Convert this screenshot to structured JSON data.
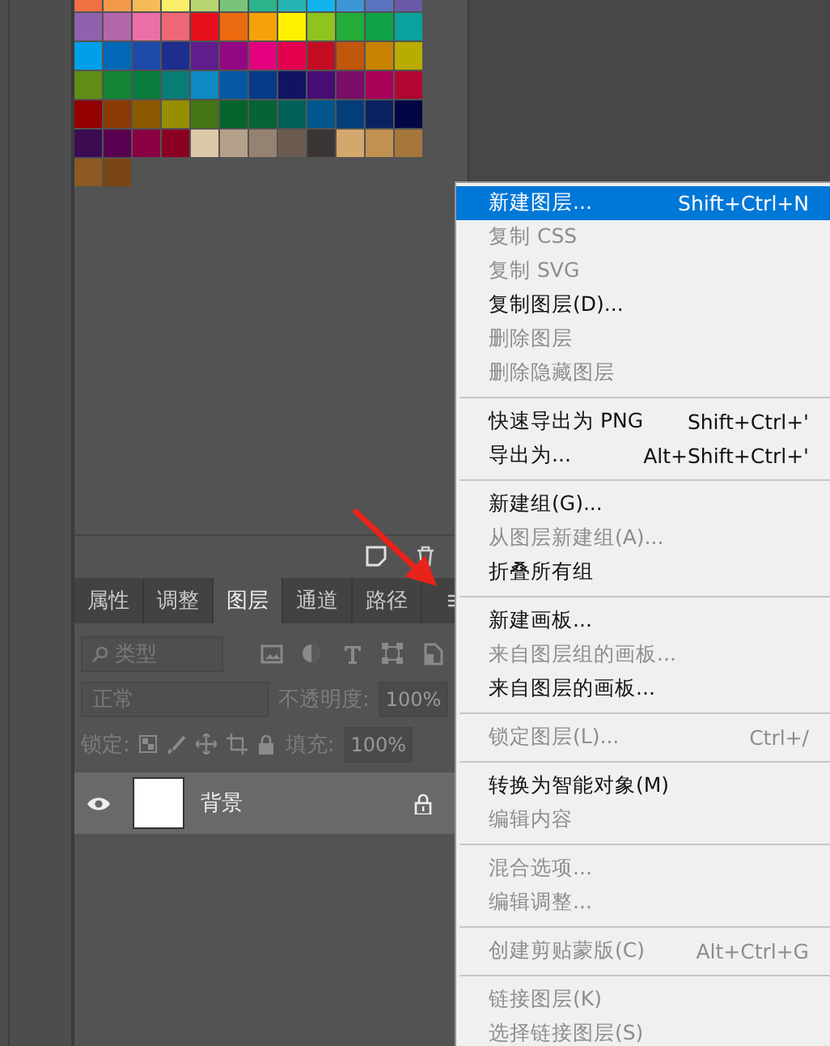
{
  "swatches": [
    {
      "color": "#ee7043"
    },
    {
      "color": "#f4994a"
    },
    {
      "color": "#f7bc57"
    },
    {
      "color": "#fbee6a"
    },
    {
      "color": "#b6d66f"
    },
    {
      "color": "#7ac37d"
    },
    {
      "color": "#2bb38a"
    },
    {
      "color": "#25b5b5"
    },
    {
      "color": "#10b4ef"
    },
    {
      "color": "#3f96d6"
    },
    {
      "color": "#5b73be"
    },
    {
      "color": "#6c5aa9"
    },
    {
      "color": "#8e62ac"
    },
    {
      "color": "#b466ab"
    },
    {
      "color": "#ea6fa6"
    },
    {
      "color": "#ee6777"
    },
    {
      "color": "#e6101d"
    },
    {
      "color": "#ec6b10"
    },
    {
      "color": "#f6a10a"
    },
    {
      "color": "#fff000"
    },
    {
      "color": "#8fc31f"
    },
    {
      "color": "#23ac38"
    },
    {
      "color": "#0ea244"
    },
    {
      "color": "#0aa29c"
    },
    {
      "color": "#00a0e9"
    },
    {
      "color": "#0068b7"
    },
    {
      "color": "#1d4aa7"
    },
    {
      "color": "#1d2e8f"
    },
    {
      "color": "#601e8d"
    },
    {
      "color": "#920783"
    },
    {
      "color": "#e4007f"
    },
    {
      "color": "#e5004f"
    },
    {
      "color": "#c30d23"
    },
    {
      "color": "#c0570c"
    },
    {
      "color": "#c68200"
    },
    {
      "color": "#b9ac00"
    },
    {
      "color": "#5f8d16"
    },
    {
      "color": "#138432"
    },
    {
      "color": "#0a7c3d"
    },
    {
      "color": "#097c74"
    },
    {
      "color": "#0d8ac2"
    },
    {
      "color": "#0559a4"
    },
    {
      "color": "#073a87"
    },
    {
      "color": "#101463"
    },
    {
      "color": "#460e74"
    },
    {
      "color": "#790d69"
    },
    {
      "color": "#a90058"
    },
    {
      "color": "#b00631"
    },
    {
      "color": "#920000"
    },
    {
      "color": "#8b3a06"
    },
    {
      "color": "#8c5a00"
    },
    {
      "color": "#978e00"
    },
    {
      "color": "#457415"
    },
    {
      "color": "#05642b"
    },
    {
      "color": "#076236"
    },
    {
      "color": "#03615c"
    },
    {
      "color": "#01568d"
    },
    {
      "color": "#043e7a"
    },
    {
      "color": "#0a2260"
    },
    {
      "color": "#000744"
    },
    {
      "color": "#3b0c52"
    },
    {
      "color": "#5a0050"
    },
    {
      "color": "#8a0042"
    },
    {
      "color": "#8a0022"
    },
    {
      "color": "#dcc9a9"
    },
    {
      "color": "#b5a18a"
    },
    {
      "color": "#958371"
    },
    {
      "color": "#6c5c50"
    },
    {
      "color": "#3b3635"
    },
    {
      "color": "#d4a76c"
    },
    {
      "color": "#c19152"
    },
    {
      "color": "#a5773d"
    },
    {
      "color": "#8c5a22"
    },
    {
      "color": "#7a4514"
    }
  ],
  "layers_panel": {
    "tabs": [
      {
        "label": "属性",
        "selected": false
      },
      {
        "label": "调整",
        "selected": false
      },
      {
        "label": "图层",
        "selected": true
      },
      {
        "label": "通道",
        "selected": false
      },
      {
        "label": "路径",
        "selected": false
      }
    ],
    "filter_kind": "类型",
    "blend_mode": "正常",
    "opacity_label": "不透明度:",
    "opacity": "100%",
    "lock_label": "锁定:",
    "fill_label": "填充:",
    "fill": "100%",
    "layers": [
      {
        "name": "背景",
        "visible": true,
        "locked": true
      }
    ]
  },
  "context_menu": {
    "items": [
      {
        "kind": "item",
        "label": "新建图层...",
        "shortcut": "Shift+Ctrl+N",
        "disabled": false,
        "selected": true
      },
      {
        "kind": "item",
        "label": "复制 CSS",
        "disabled": true,
        "selected": false
      },
      {
        "kind": "item",
        "label": "复制 SVG",
        "disabled": true,
        "selected": false
      },
      {
        "kind": "item",
        "label": "复制图层(D)...",
        "disabled": false,
        "selected": false
      },
      {
        "kind": "item",
        "label": "删除图层",
        "disabled": true,
        "selected": false
      },
      {
        "kind": "item",
        "label": "删除隐藏图层",
        "disabled": true,
        "selected": false
      },
      {
        "kind": "separator"
      },
      {
        "kind": "item",
        "label": "快速导出为 PNG",
        "shortcut": "Shift+Ctrl+'",
        "disabled": false,
        "selected": false
      },
      {
        "kind": "item",
        "label": "导出为...",
        "shortcut": "Alt+Shift+Ctrl+'",
        "disabled": false,
        "selected": false
      },
      {
        "kind": "separator"
      },
      {
        "kind": "item",
        "label": "新建组(G)...",
        "disabled": false,
        "selected": false
      },
      {
        "kind": "item",
        "label": "从图层新建组(A)...",
        "disabled": true,
        "selected": false
      },
      {
        "kind": "item",
        "label": "折叠所有组",
        "disabled": false,
        "selected": false
      },
      {
        "kind": "separator"
      },
      {
        "kind": "item",
        "label": "新建画板...",
        "disabled": false,
        "selected": false
      },
      {
        "kind": "item",
        "label": "来自图层组的画板...",
        "disabled": true,
        "selected": false
      },
      {
        "kind": "item",
        "label": "来自图层的画板...",
        "disabled": false,
        "selected": false
      },
      {
        "kind": "separator"
      },
      {
        "kind": "item",
        "label": "锁定图层(L)...",
        "shortcut": "Ctrl+/",
        "disabled": true,
        "selected": false
      },
      {
        "kind": "separator"
      },
      {
        "kind": "item",
        "label": "转换为智能对象(M)",
        "disabled": false,
        "selected": false
      },
      {
        "kind": "item",
        "label": "编辑内容",
        "disabled": true,
        "selected": false
      },
      {
        "kind": "separator"
      },
      {
        "kind": "item",
        "label": "混合选项...",
        "disabled": true,
        "selected": false
      },
      {
        "kind": "item",
        "label": "编辑调整...",
        "disabled": true,
        "selected": false
      },
      {
        "kind": "separator"
      },
      {
        "kind": "item",
        "label": "创建剪贴蒙版(C)",
        "shortcut": "Alt+Ctrl+G",
        "disabled": true,
        "selected": false
      },
      {
        "kind": "separator"
      },
      {
        "kind": "item",
        "label": "链接图层(K)",
        "disabled": true,
        "selected": false
      },
      {
        "kind": "item",
        "label": "选择链接图层(S)",
        "disabled": true,
        "selected": false
      }
    ]
  }
}
